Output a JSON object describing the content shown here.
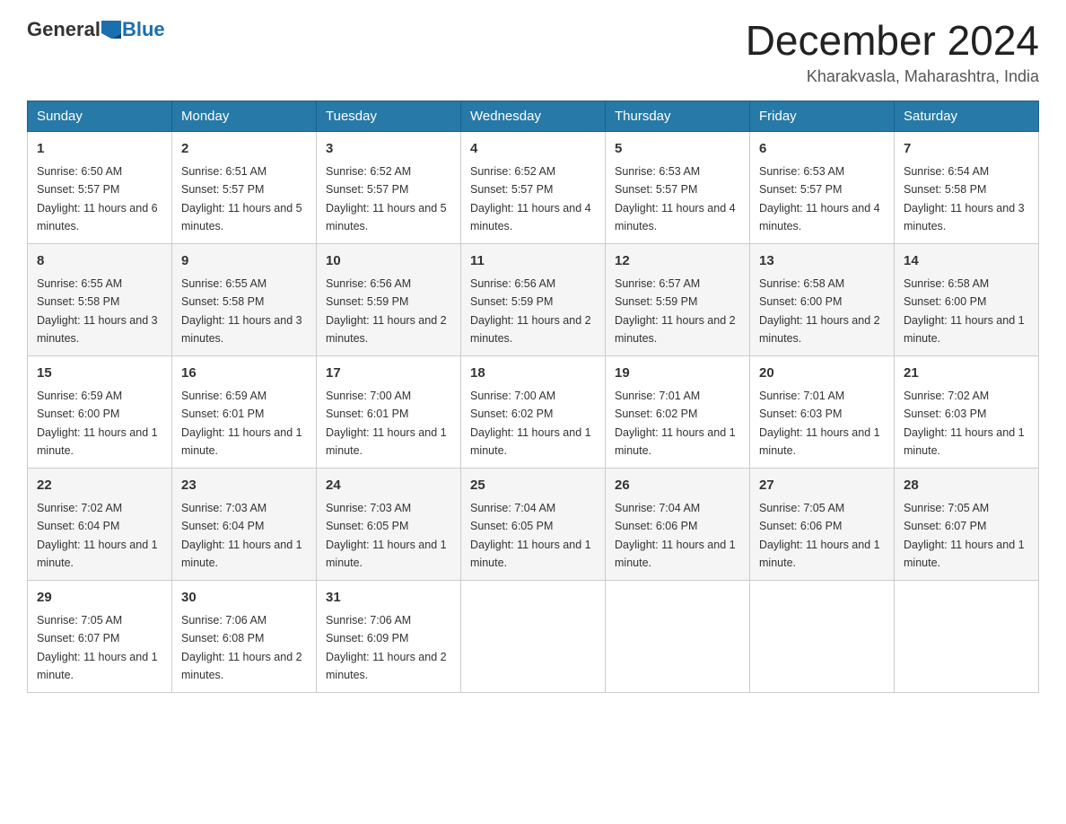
{
  "logo": {
    "general": "General",
    "blue": "Blue"
  },
  "title": "December 2024",
  "location": "Kharakvasla, Maharashtra, India",
  "days_of_week": [
    "Sunday",
    "Monday",
    "Tuesday",
    "Wednesday",
    "Thursday",
    "Friday",
    "Saturday"
  ],
  "weeks": [
    [
      {
        "day": "1",
        "sunrise": "6:50 AM",
        "sunset": "5:57 PM",
        "daylight": "11 hours and 6 minutes."
      },
      {
        "day": "2",
        "sunrise": "6:51 AM",
        "sunset": "5:57 PM",
        "daylight": "11 hours and 5 minutes."
      },
      {
        "day": "3",
        "sunrise": "6:52 AM",
        "sunset": "5:57 PM",
        "daylight": "11 hours and 5 minutes."
      },
      {
        "day": "4",
        "sunrise": "6:52 AM",
        "sunset": "5:57 PM",
        "daylight": "11 hours and 4 minutes."
      },
      {
        "day": "5",
        "sunrise": "6:53 AM",
        "sunset": "5:57 PM",
        "daylight": "11 hours and 4 minutes."
      },
      {
        "day": "6",
        "sunrise": "6:53 AM",
        "sunset": "5:57 PM",
        "daylight": "11 hours and 4 minutes."
      },
      {
        "day": "7",
        "sunrise": "6:54 AM",
        "sunset": "5:58 PM",
        "daylight": "11 hours and 3 minutes."
      }
    ],
    [
      {
        "day": "8",
        "sunrise": "6:55 AM",
        "sunset": "5:58 PM",
        "daylight": "11 hours and 3 minutes."
      },
      {
        "day": "9",
        "sunrise": "6:55 AM",
        "sunset": "5:58 PM",
        "daylight": "11 hours and 3 minutes."
      },
      {
        "day": "10",
        "sunrise": "6:56 AM",
        "sunset": "5:59 PM",
        "daylight": "11 hours and 2 minutes."
      },
      {
        "day": "11",
        "sunrise": "6:56 AM",
        "sunset": "5:59 PM",
        "daylight": "11 hours and 2 minutes."
      },
      {
        "day": "12",
        "sunrise": "6:57 AM",
        "sunset": "5:59 PM",
        "daylight": "11 hours and 2 minutes."
      },
      {
        "day": "13",
        "sunrise": "6:58 AM",
        "sunset": "6:00 PM",
        "daylight": "11 hours and 2 minutes."
      },
      {
        "day": "14",
        "sunrise": "6:58 AM",
        "sunset": "6:00 PM",
        "daylight": "11 hours and 1 minute."
      }
    ],
    [
      {
        "day": "15",
        "sunrise": "6:59 AM",
        "sunset": "6:00 PM",
        "daylight": "11 hours and 1 minute."
      },
      {
        "day": "16",
        "sunrise": "6:59 AM",
        "sunset": "6:01 PM",
        "daylight": "11 hours and 1 minute."
      },
      {
        "day": "17",
        "sunrise": "7:00 AM",
        "sunset": "6:01 PM",
        "daylight": "11 hours and 1 minute."
      },
      {
        "day": "18",
        "sunrise": "7:00 AM",
        "sunset": "6:02 PM",
        "daylight": "11 hours and 1 minute."
      },
      {
        "day": "19",
        "sunrise": "7:01 AM",
        "sunset": "6:02 PM",
        "daylight": "11 hours and 1 minute."
      },
      {
        "day": "20",
        "sunrise": "7:01 AM",
        "sunset": "6:03 PM",
        "daylight": "11 hours and 1 minute."
      },
      {
        "day": "21",
        "sunrise": "7:02 AM",
        "sunset": "6:03 PM",
        "daylight": "11 hours and 1 minute."
      }
    ],
    [
      {
        "day": "22",
        "sunrise": "7:02 AM",
        "sunset": "6:04 PM",
        "daylight": "11 hours and 1 minute."
      },
      {
        "day": "23",
        "sunrise": "7:03 AM",
        "sunset": "6:04 PM",
        "daylight": "11 hours and 1 minute."
      },
      {
        "day": "24",
        "sunrise": "7:03 AM",
        "sunset": "6:05 PM",
        "daylight": "11 hours and 1 minute."
      },
      {
        "day": "25",
        "sunrise": "7:04 AM",
        "sunset": "6:05 PM",
        "daylight": "11 hours and 1 minute."
      },
      {
        "day": "26",
        "sunrise": "7:04 AM",
        "sunset": "6:06 PM",
        "daylight": "11 hours and 1 minute."
      },
      {
        "day": "27",
        "sunrise": "7:05 AM",
        "sunset": "6:06 PM",
        "daylight": "11 hours and 1 minute."
      },
      {
        "day": "28",
        "sunrise": "7:05 AM",
        "sunset": "6:07 PM",
        "daylight": "11 hours and 1 minute."
      }
    ],
    [
      {
        "day": "29",
        "sunrise": "7:05 AM",
        "sunset": "6:07 PM",
        "daylight": "11 hours and 1 minute."
      },
      {
        "day": "30",
        "sunrise": "7:06 AM",
        "sunset": "6:08 PM",
        "daylight": "11 hours and 2 minutes."
      },
      {
        "day": "31",
        "sunrise": "7:06 AM",
        "sunset": "6:09 PM",
        "daylight": "11 hours and 2 minutes."
      },
      null,
      null,
      null,
      null
    ]
  ]
}
